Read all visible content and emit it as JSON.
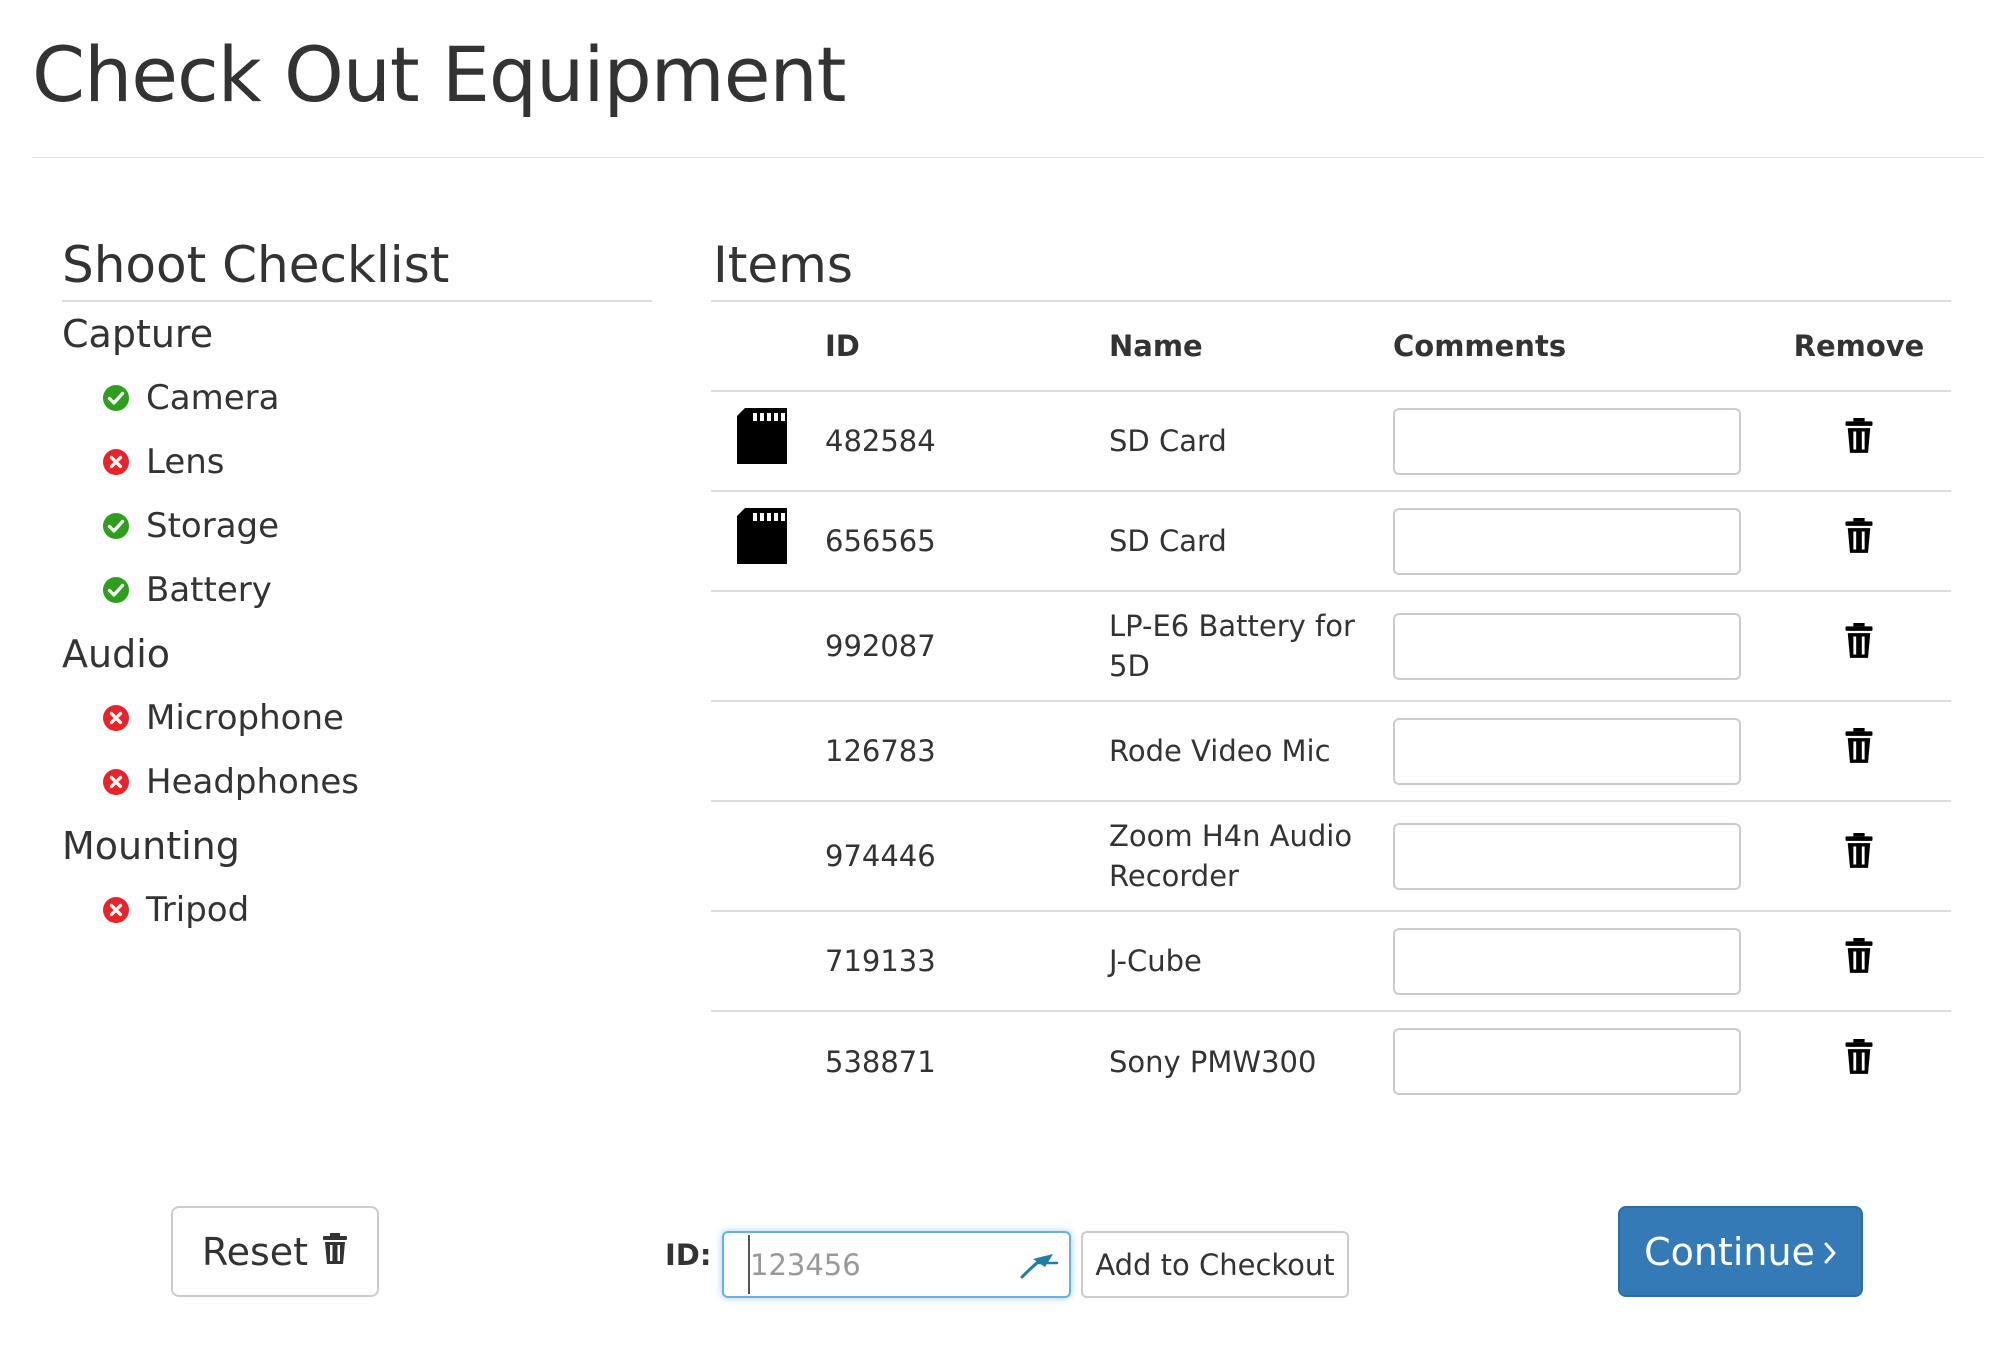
{
  "page": {
    "title": "Check Out Equipment"
  },
  "checklist": {
    "title": "Shoot Checklist",
    "categories": [
      {
        "name": "Capture",
        "items": [
          {
            "label": "Camera",
            "status": "ok",
            "icon": "check-circle-icon"
          },
          {
            "label": "Lens",
            "status": "missing",
            "icon": "x-circle-icon"
          },
          {
            "label": "Storage",
            "status": "ok",
            "icon": "check-circle-icon"
          },
          {
            "label": "Battery",
            "status": "ok",
            "icon": "check-circle-icon"
          }
        ]
      },
      {
        "name": "Audio",
        "items": [
          {
            "label": "Microphone",
            "status": "missing",
            "icon": "x-circle-icon"
          },
          {
            "label": "Headphones",
            "status": "missing",
            "icon": "x-circle-icon"
          }
        ]
      },
      {
        "name": "Mounting",
        "items": [
          {
            "label": "Tripod",
            "status": "missing",
            "icon": "x-circle-icon"
          }
        ]
      }
    ]
  },
  "items": {
    "title": "Items",
    "columns": {
      "id": "ID",
      "name": "Name",
      "comments": "Comments",
      "remove": "Remove"
    },
    "rows": [
      {
        "icon": "sd-card-icon",
        "id": "482584",
        "name": "SD Card",
        "comment": ""
      },
      {
        "icon": "sd-card-icon",
        "id": "656565",
        "name": "SD Card",
        "comment": ""
      },
      {
        "icon": "",
        "id": "992087",
        "name": "LP-E6 Battery for 5D",
        "comment": ""
      },
      {
        "icon": "",
        "id": "126783",
        "name": "Rode Video Mic",
        "comment": ""
      },
      {
        "icon": "",
        "id": "974446",
        "name": "Zoom H4n Audio Recorder",
        "comment": ""
      },
      {
        "icon": "",
        "id": "719133",
        "name": "J-Cube",
        "comment": ""
      },
      {
        "icon": "",
        "id": "538871",
        "name": "Sony PMW300",
        "comment": ""
      }
    ]
  },
  "footer": {
    "reset_label": "Reset",
    "reset_icon": "trash-icon",
    "id_label": "ID:",
    "id_placeholder": "123456",
    "id_value": "",
    "add_label": "Add to Checkout",
    "continue_label": "Continue",
    "continue_icon": "chevron-right-icon"
  },
  "colors": {
    "ok": "#2e9e1f",
    "missing": "#e8242b",
    "primary": "#337ab7",
    "focus": "#66afe9"
  }
}
